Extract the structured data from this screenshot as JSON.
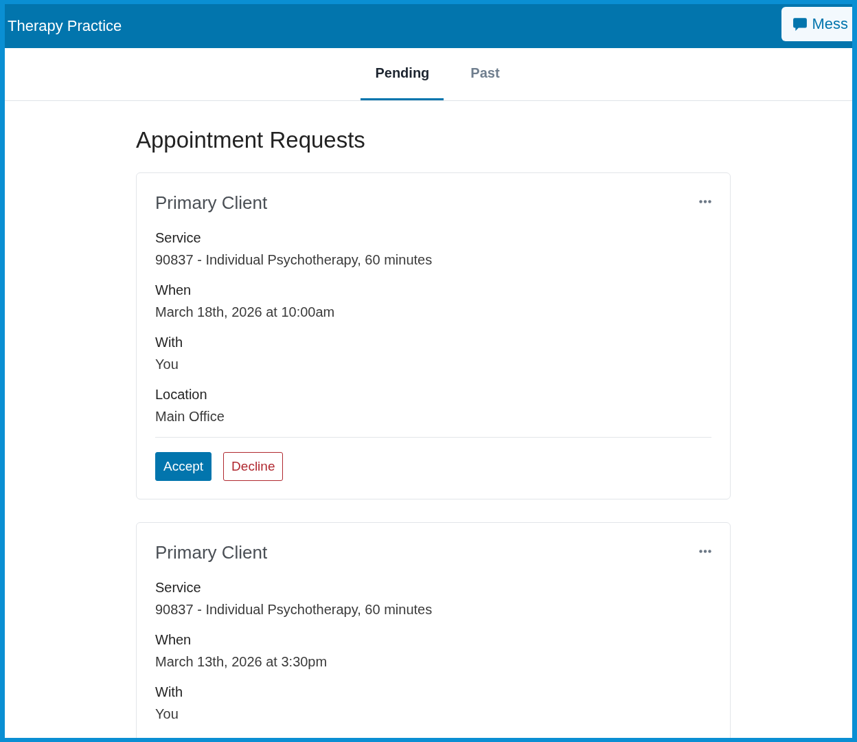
{
  "header": {
    "title": "Therapy Practice",
    "message_button": "Mess"
  },
  "tabs": [
    {
      "label": "Pending",
      "selected": true
    },
    {
      "label": "Past",
      "selected": false
    }
  ],
  "page_title": "Appointment Requests",
  "requests": [
    {
      "client": "Primary Client",
      "fields": [
        {
          "label": "Service",
          "value": "90837 - Individual Psychotherapy, 60 minutes"
        },
        {
          "label": "When",
          "value": "March 18th, 2026 at 10:00am"
        },
        {
          "label": "With",
          "value": "You"
        },
        {
          "label": "Location",
          "value": "Main Office"
        }
      ],
      "actions": [
        {
          "label": "Accept",
          "kind": "primary"
        },
        {
          "label": "Decline",
          "kind": "danger"
        }
      ]
    },
    {
      "client": "Primary Client",
      "fields": [
        {
          "label": "Service",
          "value": "90837 - Individual Psychotherapy, 60 minutes"
        },
        {
          "label": "When",
          "value": "March 13th, 2026 at 3:30pm"
        },
        {
          "label": "With",
          "value": "You"
        }
      ]
    }
  ]
}
